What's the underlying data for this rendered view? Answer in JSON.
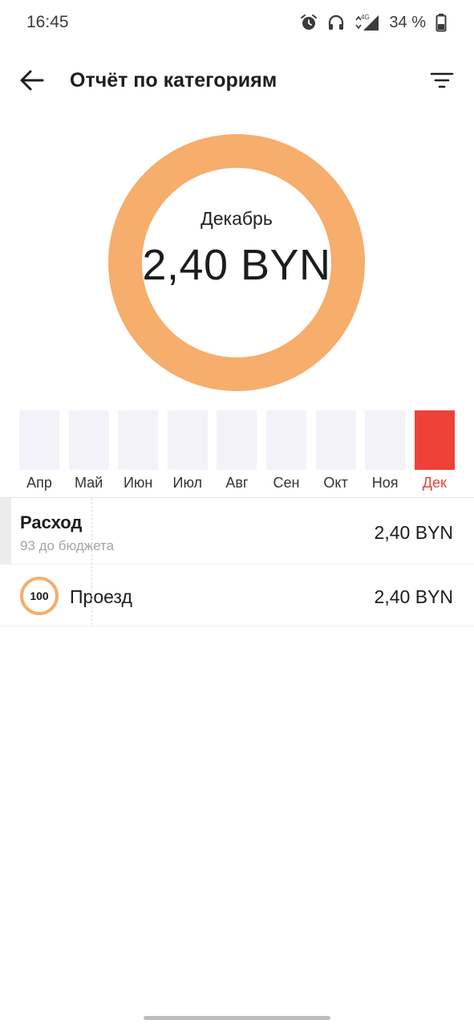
{
  "status_bar": {
    "time": "16:45",
    "network": "4G",
    "battery": "34 %",
    "icons": [
      "alarm-icon",
      "headphones-icon",
      "signal-icon",
      "battery-icon"
    ]
  },
  "app_bar": {
    "title": "Отчёт по категориям",
    "back_icon": "arrow-left-icon",
    "filter_icon": "filter-icon"
  },
  "summary": {
    "month": "Декабрь",
    "amount": "2,40 BYN",
    "ring_color": "#f7ad6b",
    "ring_fill_percent": 100
  },
  "months": [
    {
      "label": "Апр",
      "active": false
    },
    {
      "label": "Май",
      "active": false
    },
    {
      "label": "Июн",
      "active": false
    },
    {
      "label": "Июл",
      "active": false
    },
    {
      "label": "Авг",
      "active": false
    },
    {
      "label": "Сен",
      "active": false
    },
    {
      "label": "Окт",
      "active": false
    },
    {
      "label": "Ноя",
      "active": false
    },
    {
      "label": "Дек",
      "active": true
    }
  ],
  "colors": {
    "accent_active": "#ee4137",
    "bar_inactive": "#f2f2f8",
    "ring": "#f7ad6b"
  },
  "expense": {
    "title": "Расход",
    "subtitle": "93 до бюджета",
    "amount": "2,40 BYN"
  },
  "categories": [
    {
      "percent": "100",
      "name": "Проезд",
      "amount": "2,40 BYN",
      "ring_color": "#f7ad6b"
    }
  ]
}
